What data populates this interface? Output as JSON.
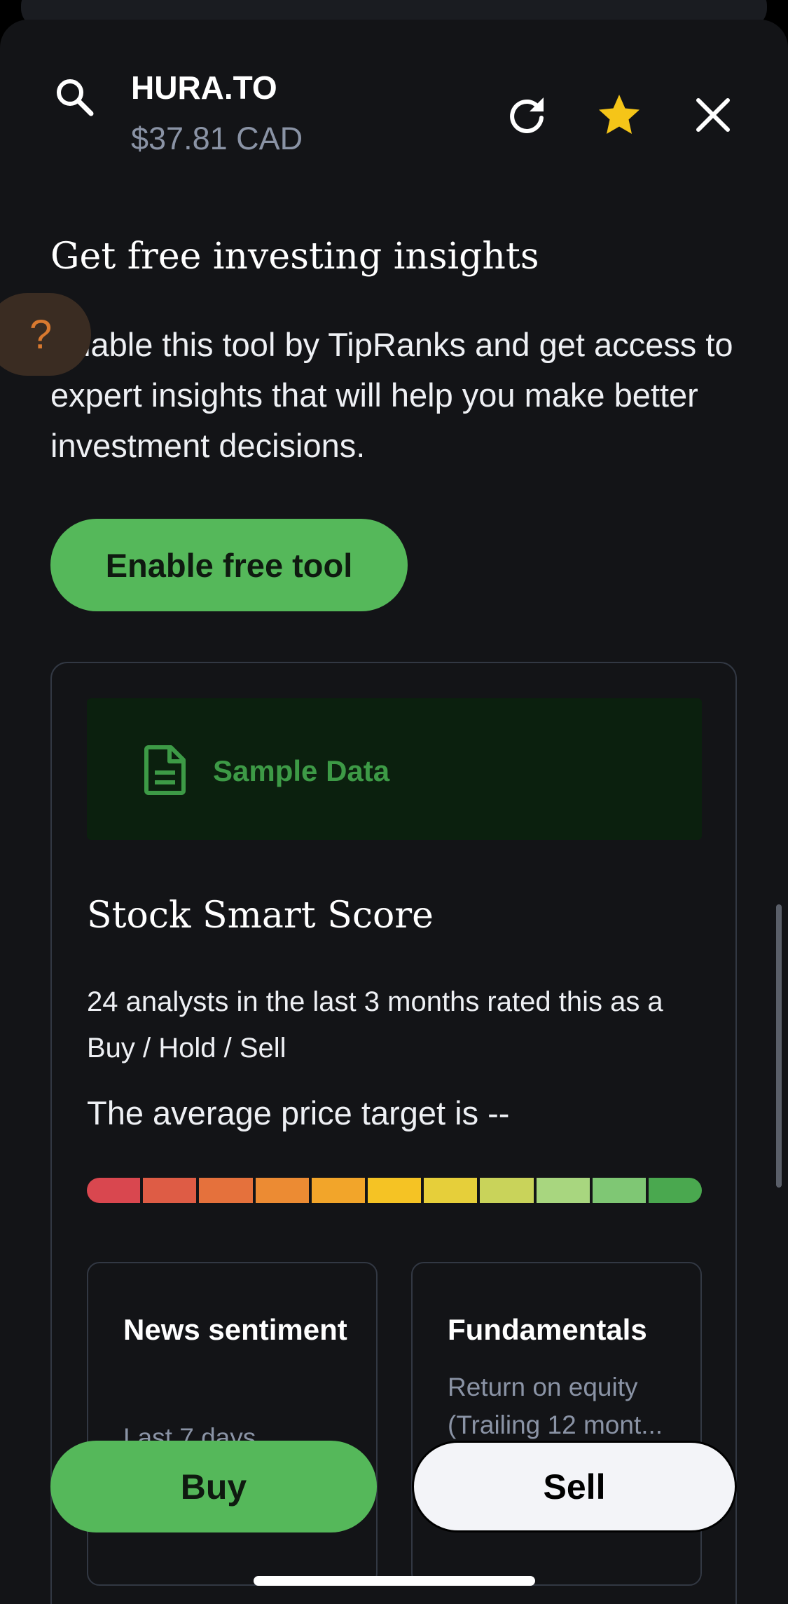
{
  "header": {
    "ticker": "HURA.TO",
    "price": "$37.81 CAD",
    "icons": {
      "search": "search-icon",
      "refresh": "refresh-icon",
      "favorite": "star-icon",
      "close": "close-icon"
    }
  },
  "promo": {
    "title": "Get free investing insights",
    "body": "Enable this tool by TipRanks and get access to expert insights that will help you make better investment decisions.",
    "button_label": "Enable free tool",
    "help_label": "?"
  },
  "card": {
    "banner_label": "Sample Data",
    "title": "Stock Smart Score",
    "analysts_text": "24 analysts in the last 3 months rated this as a Buy / Hold / Sell",
    "average_target": "The average price target is --",
    "score_bar_colors": [
      "#d9474f",
      "#de5c45",
      "#e5713c",
      "#ec8b33",
      "#f2a52a",
      "#f5c324",
      "#e6cf3a",
      "#c9d35a",
      "#a8d67f",
      "#7fc774",
      "#4aa84f"
    ],
    "mini_cards": [
      {
        "title": "News sentiment",
        "subtitle": "Last 7 days"
      },
      {
        "title": "Fundamentals",
        "subtitle": "Return on equity (Trailing 12 mont..."
      }
    ]
  },
  "actions": {
    "buy_label": "Buy",
    "sell_label": "Sell"
  },
  "colors": {
    "accent_green": "#55b85a",
    "star": "#f5c518",
    "background": "#131417"
  }
}
